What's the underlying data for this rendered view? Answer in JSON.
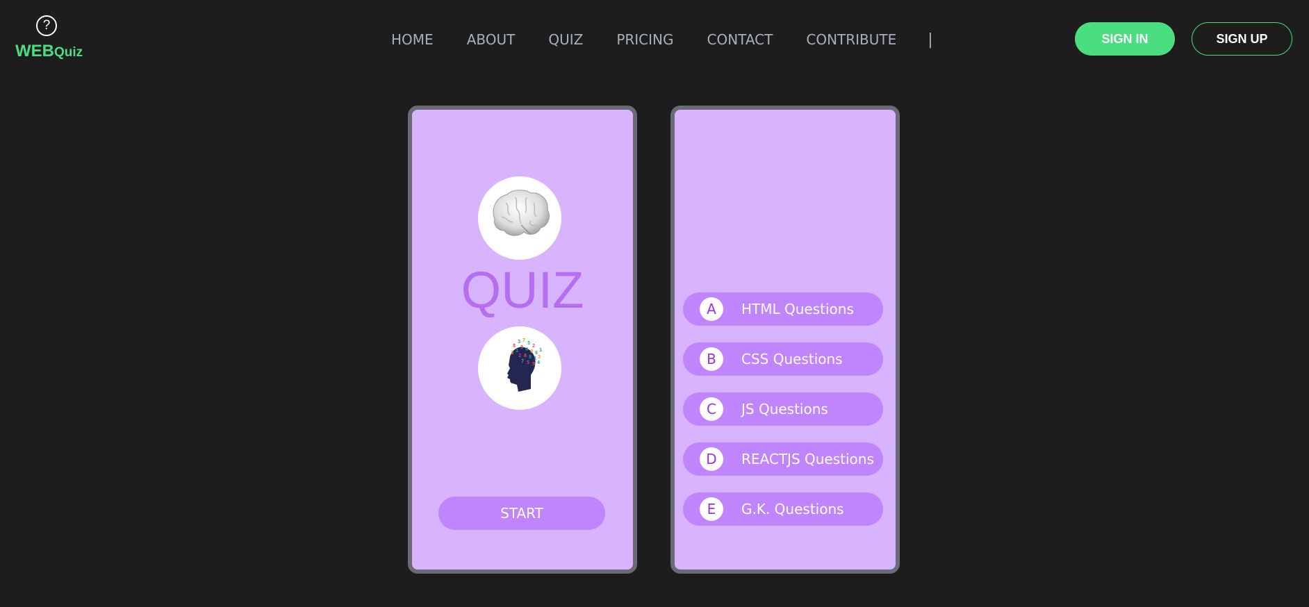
{
  "brand": {
    "word1": "WEB",
    "word2": "Quiz",
    "icon": "question-circle-icon",
    "color": "#4ade80"
  },
  "nav": {
    "items": [
      {
        "label": "HOME"
      },
      {
        "label": "ABOUT"
      },
      {
        "label": "QUIZ"
      },
      {
        "label": "PRICING"
      },
      {
        "label": "CONTACT"
      },
      {
        "label": "CONTRIBUTE"
      }
    ],
    "separator": "|"
  },
  "auth": {
    "sign_in": "SIGN IN",
    "sign_up": "SIGN UP"
  },
  "quiz_card": {
    "title": "QUIZ",
    "start_label": "START",
    "images": [
      "brain-icon",
      "head-icon"
    ]
  },
  "options": [
    {
      "letter": "A",
      "label": "HTML Questions"
    },
    {
      "letter": "B",
      "label": "CSS Questions"
    },
    {
      "letter": "C",
      "label": "JS Questions"
    },
    {
      "letter": "D",
      "label": "REACTJS Questions"
    },
    {
      "letter": "E",
      "label": "G.K. Questions"
    }
  ],
  "colors": {
    "background": "#1d1d1d",
    "accent": "#4ade80",
    "card": "#d8b4fe",
    "button": "#c084fc",
    "quiz_title": "#b56ef2"
  }
}
